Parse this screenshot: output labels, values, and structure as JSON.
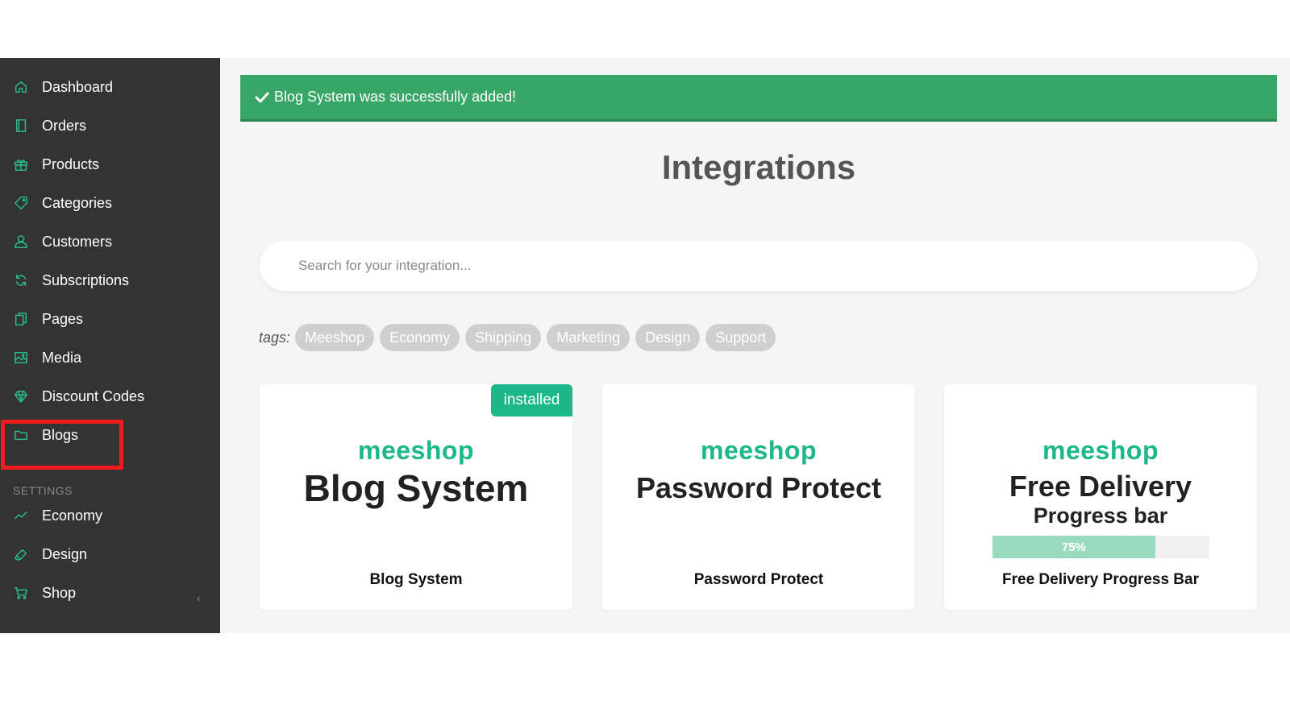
{
  "sidebar": {
    "items": [
      {
        "label": "Dashboard",
        "icon": "home-icon"
      },
      {
        "label": "Orders",
        "icon": "book-icon"
      },
      {
        "label": "Products",
        "icon": "gift-icon"
      },
      {
        "label": "Categories",
        "icon": "tag-icon"
      },
      {
        "label": "Customers",
        "icon": "user-icon"
      },
      {
        "label": "Subscriptions",
        "icon": "refresh-icon"
      },
      {
        "label": "Pages",
        "icon": "pages-icon"
      },
      {
        "label": "Media",
        "icon": "image-icon"
      },
      {
        "label": "Discount Codes",
        "icon": "diamond-icon"
      },
      {
        "label": "Blogs",
        "icon": "folder-icon"
      }
    ],
    "settings_header": "SETTINGS",
    "settings_items": [
      {
        "label": "Economy",
        "icon": "trend-icon"
      },
      {
        "label": "Design",
        "icon": "palette-icon"
      },
      {
        "label": "Shop",
        "icon": "cart-icon"
      }
    ],
    "collapse_glyph": "‹",
    "icon_color": "#2bbf8c"
  },
  "alert": {
    "text": "Blog System was successfully added!",
    "color": "#37a666"
  },
  "page_title": "Integrations",
  "search": {
    "placeholder": "Search for your integration...",
    "value": ""
  },
  "tags": {
    "label": "tags:",
    "items": [
      "Meeshop",
      "Economy",
      "Shipping",
      "Marketing",
      "Design",
      "Support"
    ]
  },
  "cards": [
    {
      "brand": "meeshop",
      "logo_title": "Blog System",
      "name": "Blog System",
      "badge": "installed"
    },
    {
      "brand": "meeshop",
      "logo_title": "Password Protect",
      "name": "Password Protect"
    },
    {
      "brand": "meeshop",
      "logo_title": "Free Delivery",
      "logo_subtitle": "Progress bar",
      "progress_label": "75%",
      "progress_value": 0.75,
      "name": "Free Delivery Progress Bar"
    }
  ],
  "accent_color": "#1cb88a"
}
